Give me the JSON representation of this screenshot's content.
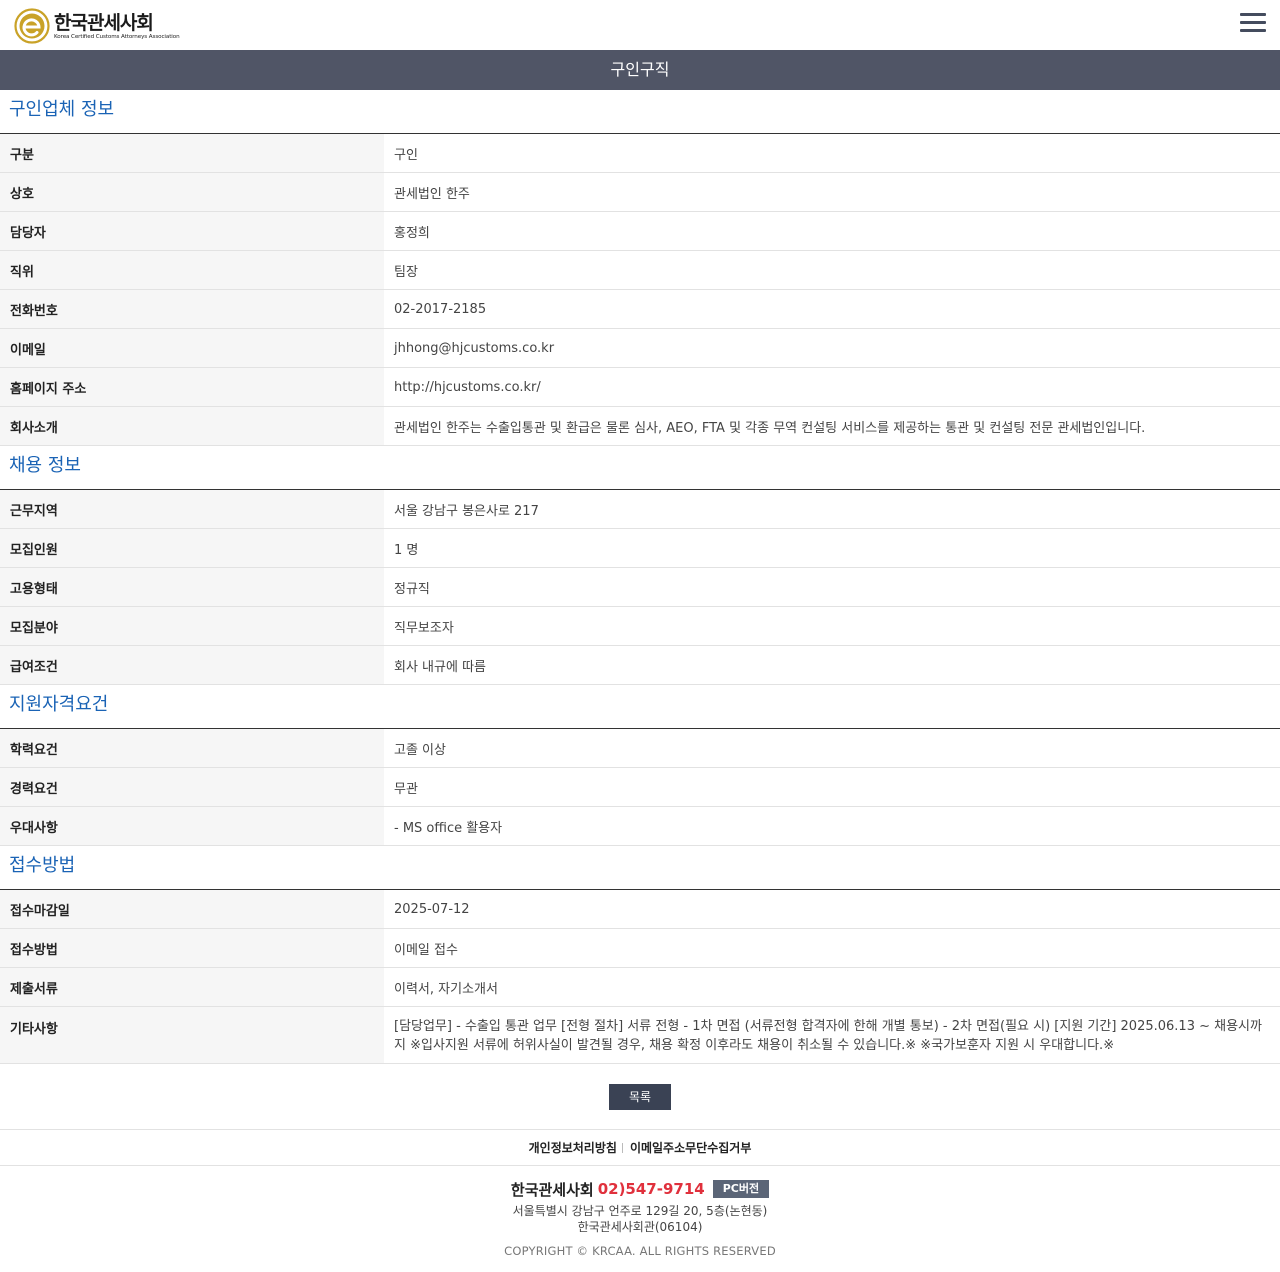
{
  "header": {
    "logo_ko": "한국관세사회",
    "logo_en": "Korea Certified Customs Attorneys Association",
    "logo_color": "#c9a227"
  },
  "page_title": "구인구직",
  "sections": [
    {
      "title": "구인업체 정보",
      "rows": [
        {
          "label": "구분",
          "value": "구인"
        },
        {
          "label": "상호",
          "value": "관세법인 한주"
        },
        {
          "label": "담당자",
          "value": "홍정희"
        },
        {
          "label": "직위",
          "value": "팀장"
        },
        {
          "label": "전화번호",
          "value": "02-2017-2185"
        },
        {
          "label": "이메일",
          "value": "jhhong@hjcustoms.co.kr"
        },
        {
          "label": "홈페이지 주소",
          "value": "http://hjcustoms.co.kr/"
        },
        {
          "label": "회사소개",
          "value": "관세법인 한주는 수출입통관 및 환급은 물론 심사, AEO, FTA 및 각종 무역 컨설팅 서비스를 제공하는 통관 및 컨설팅 전문 관세법인입니다."
        }
      ]
    },
    {
      "title": "채용 정보",
      "rows": [
        {
          "label": "근무지역",
          "value": "서울 강남구 봉은사로 217"
        },
        {
          "label": "모집인원",
          "value": "1 명"
        },
        {
          "label": "고용형태",
          "value": "정규직"
        },
        {
          "label": "모집분야",
          "value": "직무보조자"
        },
        {
          "label": "급여조건",
          "value": "회사 내규에 따름"
        }
      ]
    },
    {
      "title": "지원자격요건",
      "rows": [
        {
          "label": "학력요건",
          "value": "고졸 이상"
        },
        {
          "label": "경력요건",
          "value": "무관"
        },
        {
          "label": "우대사항",
          "value": "- MS office 활용자"
        }
      ]
    },
    {
      "title": "접수방법",
      "rows": [
        {
          "label": "접수마감일",
          "value": "2025-07-12"
        },
        {
          "label": "접수방법",
          "value": "이메일 접수"
        },
        {
          "label": "제출서류",
          "value": "이력서, 자기소개서"
        },
        {
          "label": "기타사항",
          "value": "[담당업무] - 수출입 통관 업무 [전형 절차] 서류 전형 - 1차 면접 (서류전형 합격자에 한해 개별 통보) - 2차 면접(필요 시) [지원 기간] 2025.06.13 ~ 채용시까지 ※입사지원 서류에 허위사실이 발견될 경우, 채용 확정 이후라도 채용이 취소될 수 있습니다.※ ※국가보훈자 지원 시 우대합니다.※"
        }
      ]
    }
  ],
  "buttons": {
    "list": "목록"
  },
  "policy_links": [
    "개인정보처리방침",
    "이메일주소무단수집거부"
  ],
  "footer": {
    "name": "한국관세사회",
    "phone": "02)547-9714",
    "pc_button": "PC버전",
    "address_line1": "서울특별시 강남구 언주로 129길 20, 5층(논현동)",
    "address_line2": "한국관세사회관(06104)",
    "copyright": "COPYRIGHT © KRCAA. ALL RIGHTS RESERVED"
  },
  "colors": {
    "title_bar": "#505566",
    "section_title": "#1a63b5",
    "phone": "#e0303c",
    "button": "#3a4254"
  }
}
